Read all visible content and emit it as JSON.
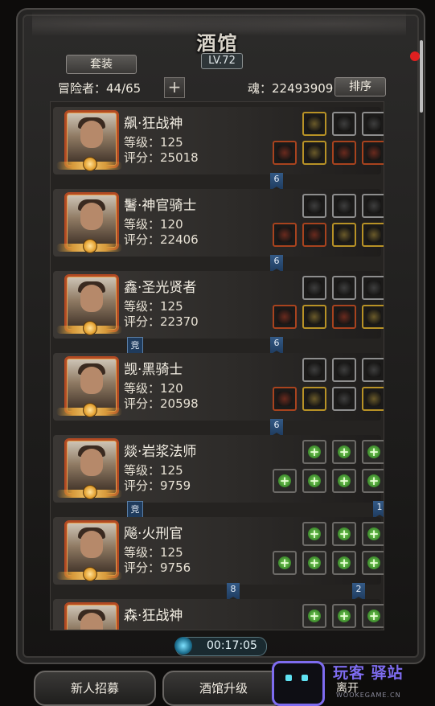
{
  "header": {
    "title": "酒馆",
    "level": "LV.72",
    "outfit_button": "套装",
    "adventurers_label": "冒险者：44/65",
    "soul_label": "魂：22493909",
    "sort_button": "排序",
    "add_icon": "plus-icon"
  },
  "heroes": [
    {
      "name": "飙·狂战神",
      "level": "等级：125",
      "score": "评分：25018",
      "gear": [
        {
          "icon": "ring-icon",
          "frame": "gold"
        },
        {
          "icon": "feather-icon",
          "frame": "silver"
        },
        {
          "icon": "dagger-icon",
          "frame": "silver"
        },
        {
          "icon": "axe-icon",
          "frame": "red"
        },
        {
          "icon": "helmet-icon",
          "frame": "gold"
        },
        {
          "icon": "belt-icon",
          "frame": "red"
        },
        {
          "icon": "potion-icon",
          "frame": "red"
        }
      ],
      "ribbons": [
        {
          "label": "6"
        }
      ],
      "badges": []
    },
    {
      "name": "鬐·神官骑士",
      "level": "等级：120",
      "score": "评分：22406",
      "gear": [
        {
          "icon": "orb-icon",
          "frame": "silver"
        },
        {
          "icon": "gem-icon",
          "frame": "silver"
        },
        {
          "icon": "gem-green-icon",
          "frame": "silver"
        },
        {
          "icon": "hammer-icon",
          "frame": "red"
        },
        {
          "icon": "armor-icon",
          "frame": "red"
        },
        {
          "icon": "amulet-icon",
          "frame": "gold"
        },
        {
          "icon": "orb-blue-icon",
          "frame": "gold"
        }
      ],
      "ribbons": [
        {
          "label": "6"
        }
      ],
      "badges": []
    },
    {
      "name": "鑫·圣光贤者",
      "level": "等级：125",
      "score": "评分：22370",
      "gear": [
        {
          "icon": "cross-icon",
          "frame": "silver"
        },
        {
          "icon": "crystal-icon",
          "frame": "silver"
        },
        {
          "icon": "staff-icon",
          "frame": "silver"
        },
        {
          "icon": "sword-icon",
          "frame": "red"
        },
        {
          "icon": "robe-icon",
          "frame": "gold"
        },
        {
          "icon": "vial-icon",
          "frame": "red"
        },
        {
          "icon": "wand-icon",
          "frame": "gold"
        }
      ],
      "ribbons": [
        {
          "label": "6"
        }
      ],
      "badges": [
        {
          "label": "竞"
        }
      ]
    },
    {
      "name": "觊·黑骑士",
      "level": "等级：120",
      "score": "评分：20598",
      "gear": [
        {
          "icon": "rose-icon",
          "frame": "silver"
        },
        {
          "icon": "blade-icon",
          "frame": "silver"
        },
        {
          "icon": "chain-icon",
          "frame": "silver"
        },
        {
          "icon": "spear-icon",
          "frame": "red"
        },
        {
          "icon": "armor-dark-icon",
          "frame": "gold"
        },
        {
          "icon": "bottle-icon",
          "frame": "silver"
        },
        {
          "icon": "shield-icon",
          "frame": "gold"
        }
      ],
      "ribbons": [
        {
          "label": "6"
        }
      ],
      "badges": []
    },
    {
      "name": "燚·岩浆法师",
      "level": "等级：125",
      "score": "评分：9759",
      "gear": [
        {
          "icon": "add-slot-icon",
          "frame": "empty"
        },
        {
          "icon": "add-slot-icon",
          "frame": "empty"
        },
        {
          "icon": "add-slot-icon",
          "frame": "empty"
        },
        {
          "icon": "add-slot-icon",
          "frame": "empty"
        },
        {
          "icon": "add-slot-icon",
          "frame": "empty"
        },
        {
          "icon": "add-slot-icon",
          "frame": "empty"
        },
        {
          "icon": "add-slot-icon",
          "frame": "empty"
        }
      ],
      "ribbons": [
        {
          "label": "1"
        }
      ],
      "badges": [
        {
          "label": "竞"
        }
      ]
    },
    {
      "name": "飚·火刑官",
      "level": "等级：125",
      "score": "评分：9756",
      "gear": [
        {
          "icon": "add-slot-icon",
          "frame": "empty"
        },
        {
          "icon": "add-slot-icon",
          "frame": "empty"
        },
        {
          "icon": "add-slot-icon",
          "frame": "empty"
        },
        {
          "icon": "add-slot-icon",
          "frame": "empty"
        },
        {
          "icon": "add-slot-icon",
          "frame": "empty"
        },
        {
          "icon": "add-slot-icon",
          "frame": "empty"
        },
        {
          "icon": "add-slot-icon",
          "frame": "empty"
        }
      ],
      "ribbons": [
        {
          "label": "8"
        },
        {
          "label": "2"
        }
      ],
      "badges": []
    },
    {
      "name": "森·狂战神",
      "level": "",
      "score": "",
      "gear": [
        {
          "icon": "add-slot-icon",
          "frame": "empty"
        },
        {
          "icon": "add-slot-icon",
          "frame": "empty"
        },
        {
          "icon": "add-slot-icon",
          "frame": "empty"
        }
      ],
      "ribbons": [],
      "badges": []
    }
  ],
  "timer": {
    "value": "00:17:05",
    "icon": "clock-icon"
  },
  "bottom": {
    "recruit": "新人招募",
    "upgrade": "酒馆升级",
    "leave": "离开"
  },
  "watermark": {
    "text": "玩客 驿站",
    "sub": "WOOKEGAME.CN"
  },
  "colors": {
    "gold_frame": "#b89226",
    "red_frame": "#a8431e",
    "ribbon": "#1d3a5d",
    "accent_green": "#3c8a2c"
  }
}
